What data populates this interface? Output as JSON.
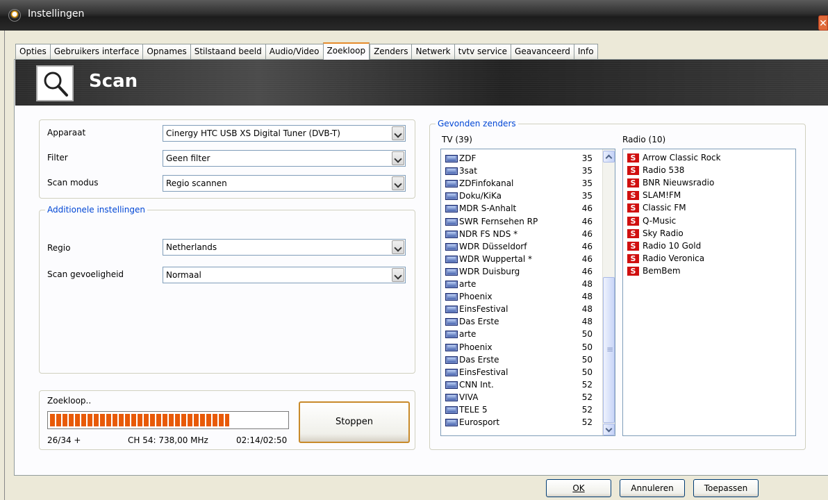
{
  "window": {
    "title": "Instellingen",
    "close_glyph": "✕"
  },
  "tabs": [
    {
      "label": "Opties"
    },
    {
      "label": "Gebruikers interface"
    },
    {
      "label": "Opnames"
    },
    {
      "label": "Stilstaand beeld"
    },
    {
      "label": "Audio/Video"
    },
    {
      "label": "Zoekloop",
      "active": true
    },
    {
      "label": "Zenders"
    },
    {
      "label": "Netwerk"
    },
    {
      "label": "tvtv service"
    },
    {
      "label": "Geavanceerd"
    },
    {
      "label": "Info"
    }
  ],
  "banner": {
    "title": "Scan",
    "icon": "search-icon"
  },
  "device": {
    "apparaat_label": "Apparaat",
    "apparaat_value": "Cinergy HTC USB XS Digital Tuner (DVB-T)",
    "filter_label": "Filter",
    "filter_value": "Geen filter",
    "scanmodus_label": "Scan modus",
    "scanmodus_value": "Regio scannen"
  },
  "additional": {
    "legend": "Additionele instellingen",
    "regio_label": "Regio",
    "regio_value": "Netherlands",
    "gevoeligheid_label": "Scan gevoeligheid",
    "gevoeligheid_value": "Normaal"
  },
  "scan": {
    "label": "Zoekloop..",
    "progress_fraction": 0.76,
    "counter": "26/34 +",
    "channel": "CH 54: 738,00 MHz",
    "time": "02:14/02:50",
    "stop_label": "Stoppen"
  },
  "found": {
    "legend": "Gevonden zenders",
    "tv_header": "TV (39)",
    "radio_header": "Radio (10)",
    "tv": [
      {
        "name": "ZDF",
        "ch": "35"
      },
      {
        "name": "3sat",
        "ch": "35"
      },
      {
        "name": "ZDFinfokanal",
        "ch": "35"
      },
      {
        "name": "Doku/KiKa",
        "ch": "35"
      },
      {
        "name": "MDR S-Anhalt",
        "ch": "46"
      },
      {
        "name": "SWR Fernsehen RP",
        "ch": "46"
      },
      {
        "name": "NDR FS NDS *",
        "ch": "46"
      },
      {
        "name": "WDR Düsseldorf",
        "ch": "46"
      },
      {
        "name": "WDR Wuppertal *",
        "ch": "46"
      },
      {
        "name": "WDR Duisburg",
        "ch": "46"
      },
      {
        "name": "arte",
        "ch": "48"
      },
      {
        "name": "Phoenix",
        "ch": "48"
      },
      {
        "name": "EinsFestival",
        "ch": "48"
      },
      {
        "name": "Das Erste",
        "ch": "48"
      },
      {
        "name": "arte",
        "ch": "50"
      },
      {
        "name": "Phoenix",
        "ch": "50"
      },
      {
        "name": "Das Erste",
        "ch": "50"
      },
      {
        "name": "EinsFestival",
        "ch": "50"
      },
      {
        "name": "CNN Int.",
        "ch": "52"
      },
      {
        "name": "VIVA",
        "ch": "52"
      },
      {
        "name": "TELE 5",
        "ch": "52"
      },
      {
        "name": "Eurosport",
        "ch": "52"
      }
    ],
    "radio": [
      {
        "name": "Arrow Classic Rock"
      },
      {
        "name": "Radio 538"
      },
      {
        "name": "BNR Nieuwsradio"
      },
      {
        "name": "SLAM!FM"
      },
      {
        "name": "Classic FM"
      },
      {
        "name": "Q-Music"
      },
      {
        "name": "Sky Radio"
      },
      {
        "name": "Radio 10 Gold"
      },
      {
        "name": "Radio Veronica"
      },
      {
        "name": "BemBem"
      }
    ],
    "radio_icon_glyph": "S"
  },
  "footer": {
    "ok_label": "OK",
    "cancel_label": "Annuleren",
    "apply_label": "Toepassen"
  }
}
